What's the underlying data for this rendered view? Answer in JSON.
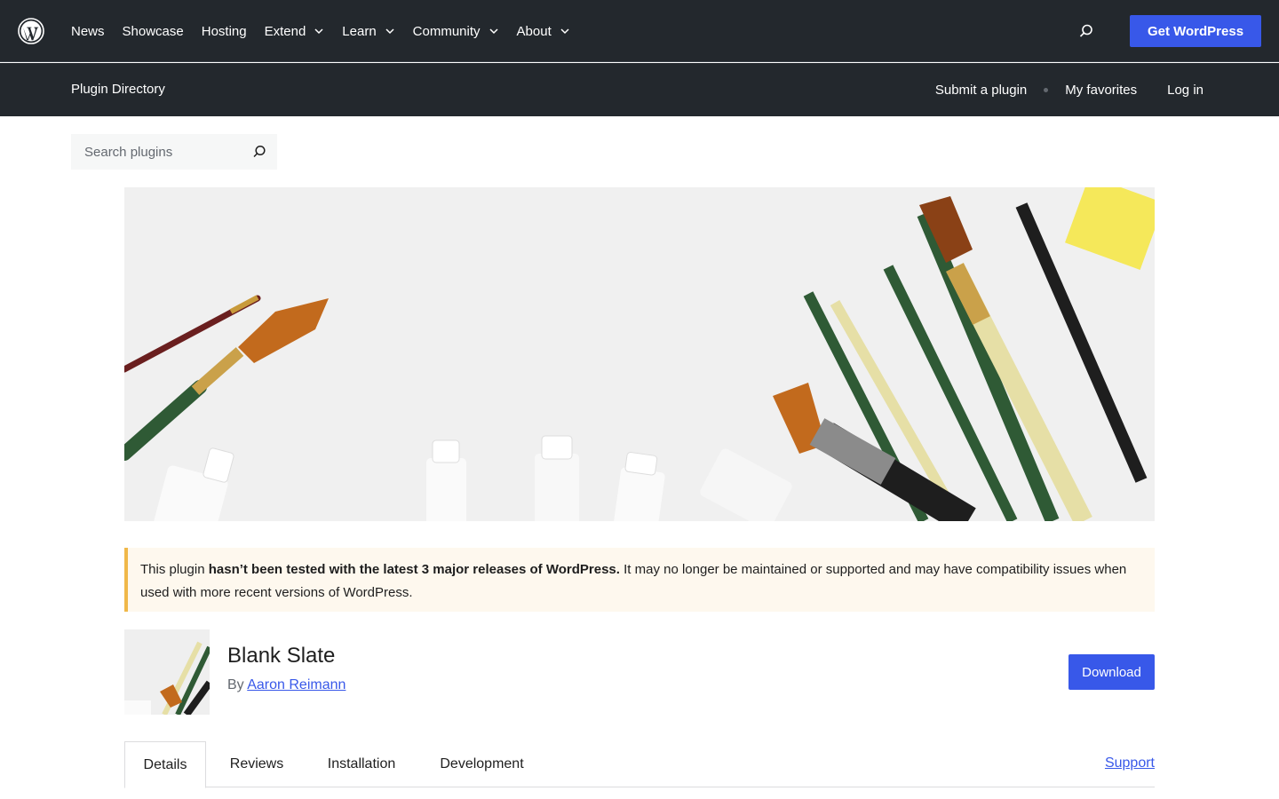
{
  "global_nav": {
    "items": [
      {
        "label": "News"
      },
      {
        "label": "Showcase"
      },
      {
        "label": "Hosting"
      },
      {
        "label": "Extend"
      },
      {
        "label": "Learn"
      },
      {
        "label": "Community"
      },
      {
        "label": "About"
      }
    ],
    "cta_label": "Get WordPress",
    "colors": {
      "bg": "#23282d",
      "accent": "#3858e9"
    }
  },
  "local_nav": {
    "title": "Plugin Directory",
    "submit_label": "Submit a plugin",
    "favorites_label": "My favorites",
    "login_label": "Log in"
  },
  "search": {
    "placeholder": "Search plugins"
  },
  "notice": {
    "prefix": "This plugin ",
    "bold": "hasn’t been tested with the latest 3 major releases of WordPress.",
    "suffix": " It may no longer be maintained or supported and may have compatibility issues when used with more recent versions of WordPress.",
    "border_color": "#f0b849"
  },
  "plugin": {
    "name": "Blank Slate",
    "by_label": "By",
    "author": "Aaron Reimann",
    "download_label": "Download"
  },
  "tabs": {
    "items": [
      {
        "label": "Details"
      },
      {
        "label": "Reviews"
      },
      {
        "label": "Installation"
      },
      {
        "label": "Development"
      }
    ],
    "active": "Details",
    "support_label": "Support"
  }
}
